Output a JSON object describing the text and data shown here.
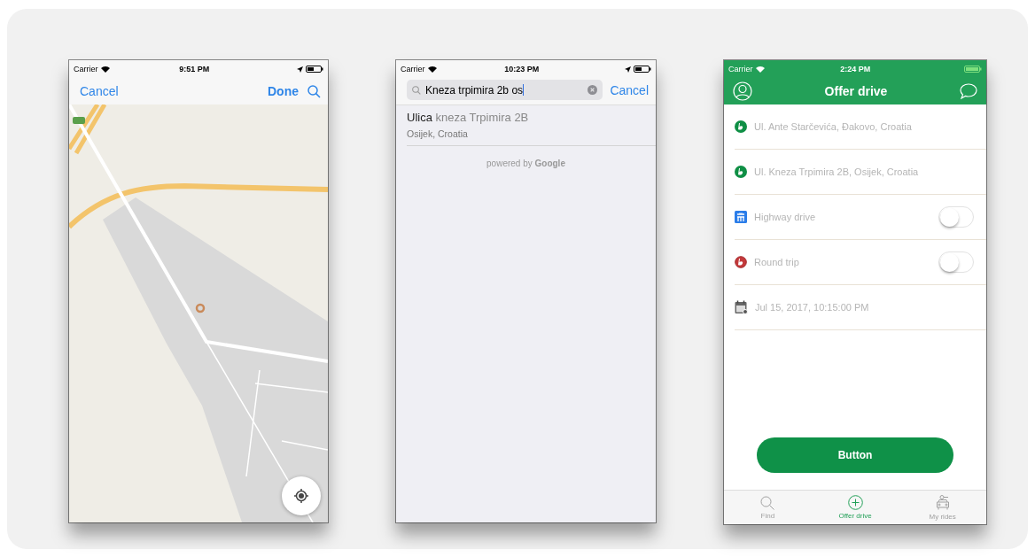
{
  "screens": [
    {
      "kind": "map_picker",
      "status_bar": {
        "carrier": "Carrier",
        "time": "9:51 PM"
      },
      "nav": {
        "cancel": "Cancel",
        "done": "Done"
      }
    },
    {
      "kind": "place_search",
      "status_bar": {
        "carrier": "Carrier",
        "time": "10:23 PM"
      },
      "search": {
        "value": "Kneza trpimira 2b os",
        "cancel": "Cancel"
      },
      "results": [
        {
          "title": "**Ulica** kneza Trpimira 2B",
          "subtitle": "Osijek, Croatia"
        }
      ],
      "attribution": "powered by **Google**"
    },
    {
      "kind": "offer_form",
      "status_bar": {
        "carrier": "Carrier",
        "time": "2:24 PM"
      },
      "title": "Offer drive",
      "rows": [
        {
          "kind": "address",
          "text": "Ul. Ante Starčevića, Đakovo, Croatia"
        },
        {
          "kind": "address",
          "text": "Ul. Kneza Trpimira 2B, Osijek, Croatia"
        },
        {
          "kind": "highway",
          "text": "Highway drive",
          "on": false
        },
        {
          "kind": "round_trip",
          "text": "Round trip",
          "on": false
        },
        {
          "kind": "date",
          "text": "Jul 15, 2017, 10:15:00 PM"
        }
      ],
      "button": "Button",
      "tabs": [
        {
          "kind": "find",
          "label": "Find",
          "selected": false
        },
        {
          "kind": "offer",
          "label": "Offer drive",
          "selected": true
        },
        {
          "kind": "rides",
          "label": "My rides",
          "selected": false
        }
      ]
    }
  ]
}
